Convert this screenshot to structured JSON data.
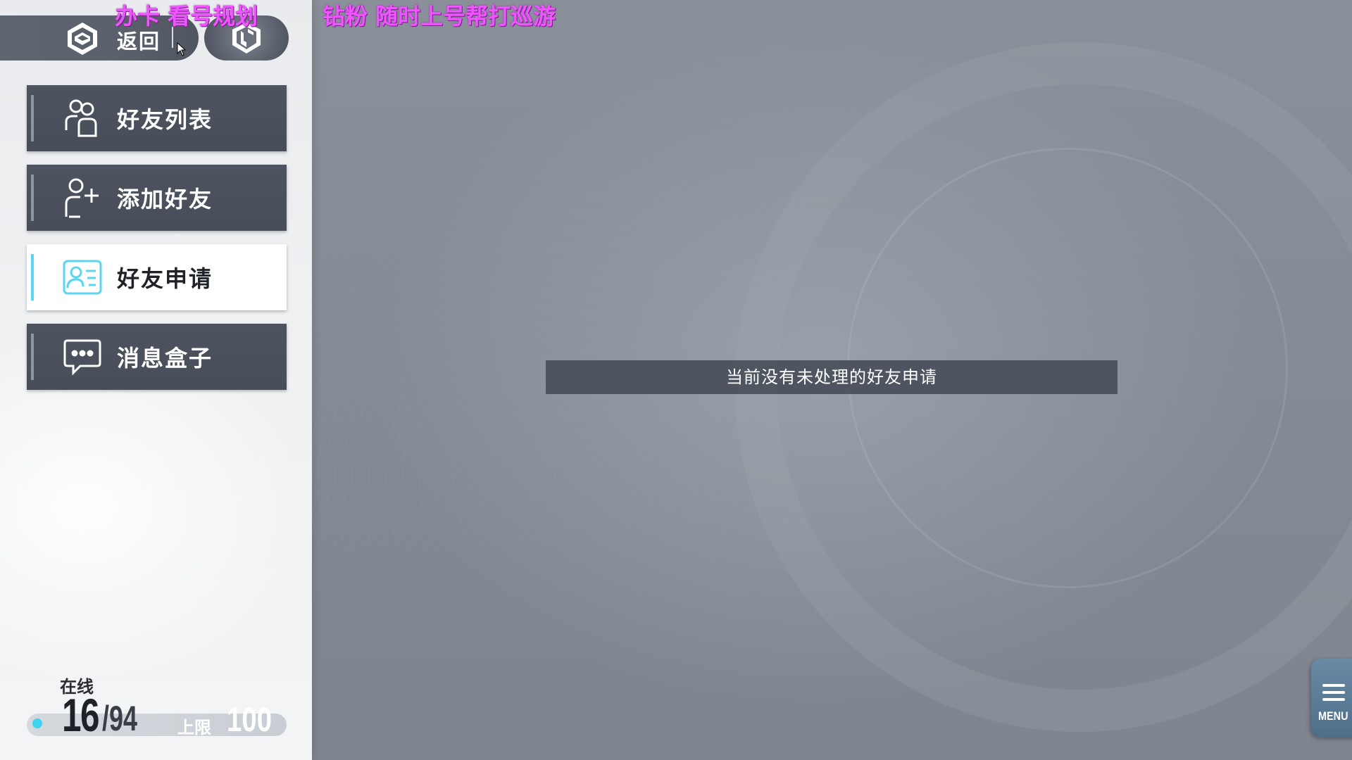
{
  "header": {
    "back_label": "返回",
    "overlay_left": "办卡 看号规划",
    "overlay_right": "钻粉 随时上号帮打巡游"
  },
  "menu": {
    "items": [
      {
        "label": "好友列表",
        "icon": "friends-list-icon",
        "active": false
      },
      {
        "label": "添加好友",
        "icon": "add-friend-icon",
        "active": false
      },
      {
        "label": "好友申请",
        "icon": "friend-request-icon",
        "active": true
      },
      {
        "label": "消息盒子",
        "icon": "message-box-icon",
        "active": false
      }
    ]
  },
  "online": {
    "label": "在线",
    "current": "16",
    "total": "/94",
    "limit_label": "上限",
    "limit_value": "100",
    "status_color": "#3ed3ef"
  },
  "main": {
    "empty_message": "当前没有未处理的好友申请"
  },
  "menu_button": {
    "label": "MENU"
  },
  "colors": {
    "accent": "#5ad6ee",
    "panel_dark": "#4d545f",
    "overlay_text": "#ef55ff"
  }
}
